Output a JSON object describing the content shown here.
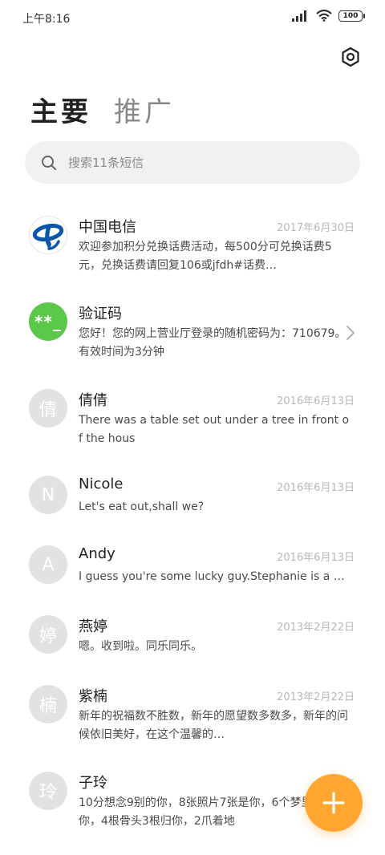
{
  "status_bar": {
    "time": "上午8:16",
    "battery": "100"
  },
  "tabs": [
    {
      "label": "主要"
    },
    {
      "label": "推广"
    }
  ],
  "search": {
    "placeholder": "搜索11条短信"
  },
  "messages": [
    {
      "name": "中国电信",
      "date": "2017年6月30日",
      "preview": "欢迎参加积分兑换话费活动，每500分可兑换话费5元，兑换话费请回复106或jfdh#话费…",
      "avatar": "telecom-logo-icon"
    },
    {
      "name": "验证码",
      "date": "",
      "preview": "您好！您的网上营业厅登录的随机密码为：710679。有效时间为3分钟",
      "avatar_text": "**_"
    },
    {
      "name": "倩倩",
      "date": "2016年6月13日",
      "preview": "There was a table set out under a tree in front of the hous",
      "avatar_text": "倩"
    },
    {
      "name": "Nicole",
      "date": "2016年6月13日",
      "preview": "Let's eat out,shall we?",
      "avatar_text": "N"
    },
    {
      "name": "Andy",
      "date": "2016年6月13日",
      "preview": "I guess you're some lucky guy.Stephanie is a nice girl.",
      "avatar_text": "A"
    },
    {
      "name": "燕婷",
      "date": "2013年2月22日",
      "preview": "嗯。收到啦。同乐同乐。",
      "avatar_text": "婷"
    },
    {
      "name": "紫楠",
      "date": "2013年2月22日",
      "preview": "新年的祝福数不胜数，新年的愿望数多数多，新年的问候依旧美好，在这个温馨的…",
      "avatar_text": "楠"
    },
    {
      "name": "子玲",
      "date": "2013年",
      "preview": "10分想念9别的你，8张照片7张是你，6个梦里5只像你，4根骨头3根归你，2爪着地",
      "avatar_text": "玲"
    }
  ],
  "colors": {
    "fab": "#ffa630",
    "verify_avatar": "#5cc84a",
    "telecom_blue": "#0a56a8"
  }
}
